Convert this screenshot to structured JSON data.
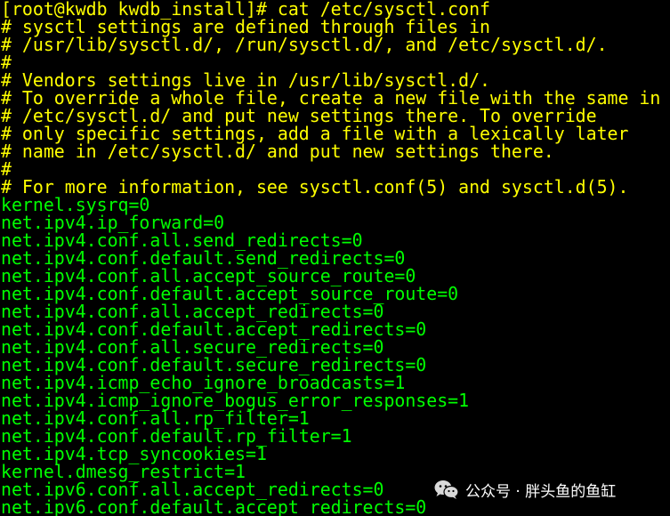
{
  "terminal": {
    "prompt_line": "[root@kwdb kwdb_install]# cat /etc/sysctl.conf",
    "comments": [
      "# sysctl settings are defined through files in",
      "# /usr/lib/sysctl.d/, /run/sysctl.d/, and /etc/sysctl.d/.",
      "#",
      "# Vendors settings live in /usr/lib/sysctl.d/.",
      "# To override a whole file, create a new file with the same in",
      "# /etc/sysctl.d/ and put new settings there. To override",
      "# only specific settings, add a file with a lexically later",
      "# name in /etc/sysctl.d/ and put new settings there.",
      "#",
      "# For more information, see sysctl.conf(5) and sysctl.d(5)."
    ],
    "settings": [
      "kernel.sysrq=0",
      "net.ipv4.ip_forward=0",
      "net.ipv4.conf.all.send_redirects=0",
      "net.ipv4.conf.default.send_redirects=0",
      "net.ipv4.conf.all.accept_source_route=0",
      "net.ipv4.conf.default.accept_source_route=0",
      "net.ipv4.conf.all.accept_redirects=0",
      "net.ipv4.conf.default.accept_redirects=0",
      "net.ipv4.conf.all.secure_redirects=0",
      "net.ipv4.conf.default.secure_redirects=0",
      "net.ipv4.icmp_echo_ignore_broadcasts=1",
      "net.ipv4.icmp_ignore_bogus_error_responses=1",
      "net.ipv4.conf.all.rp_filter=1",
      "net.ipv4.conf.default.rp_filter=1",
      "net.ipv4.tcp_syncookies=1",
      "kernel.dmesg_restrict=1",
      "net.ipv6.conf.all.accept_redirects=0",
      "net.ipv6.conf.default.accept_redirects=0"
    ]
  },
  "watermark": {
    "icon": "wechat-icon",
    "text": "公众号 · 胖头鱼的鱼缸"
  },
  "colors": {
    "background": "#000000",
    "prompt": "#ffff00",
    "comment": "#ffff00",
    "config": "#00ff00",
    "watermark": "#ffffff"
  }
}
